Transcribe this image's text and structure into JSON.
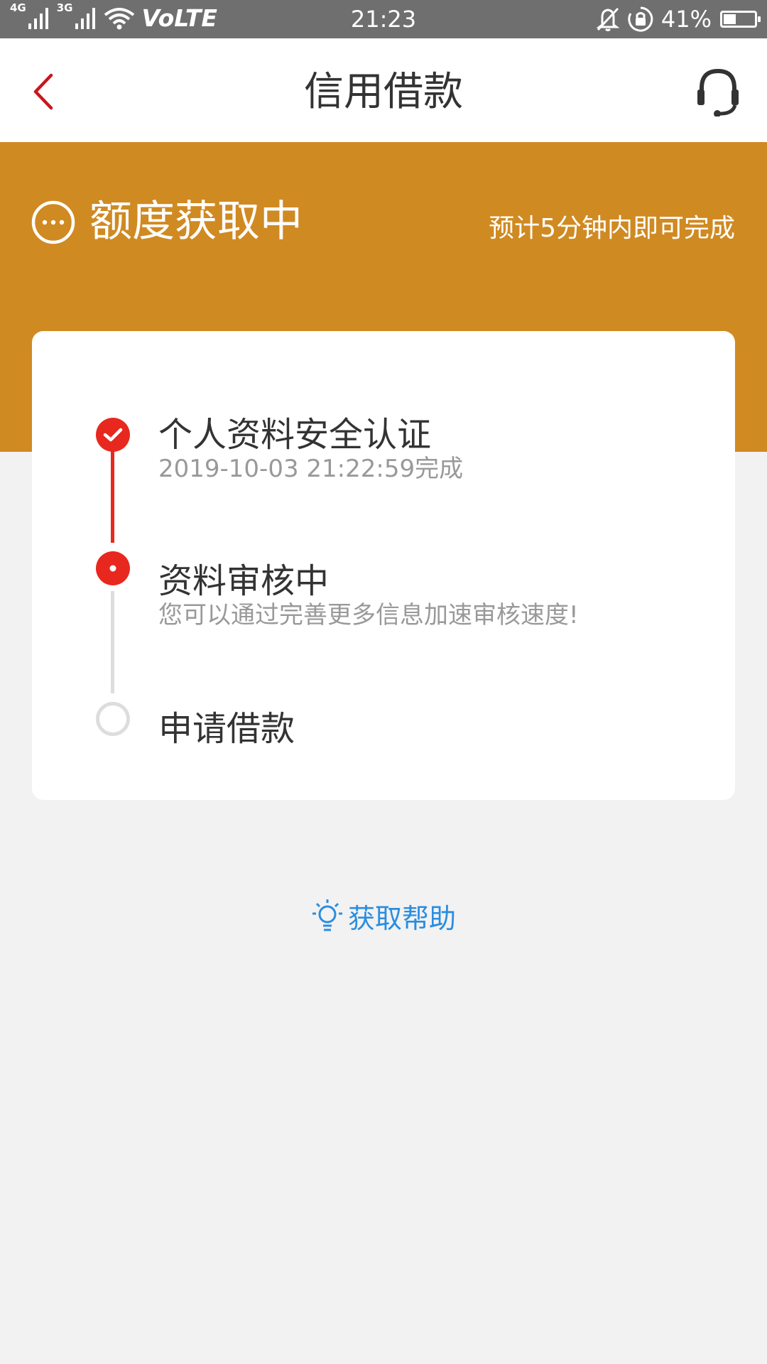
{
  "status_bar": {
    "net1": "4G",
    "net2": "3G",
    "volte": "VoLTE",
    "time": "21:23",
    "battery": "41%",
    "battery_level": 0.41
  },
  "nav": {
    "title": "信用借款",
    "back_icon": "chevron-left-icon",
    "support_icon": "headset-icon"
  },
  "banner": {
    "status_icon": "more-dots-icon",
    "title": "额度获取中",
    "eta": "预计5分钟内即可完成"
  },
  "steps": [
    {
      "title": "个人资料安全认证",
      "subtitle": "2019-10-03 21:22:59完成",
      "state": "done"
    },
    {
      "title": "资料审核中",
      "subtitle": "您可以通过完善更多信息加速审核速度!",
      "state": "current"
    },
    {
      "title": "申请借款",
      "subtitle": "",
      "state": "pending"
    }
  ],
  "help": {
    "label": "获取帮助",
    "icon": "lightbulb-icon"
  },
  "colors": {
    "accent": "#e8281e",
    "banner": "#d08a22",
    "link": "#2a8de0",
    "back": "#c8161d"
  }
}
